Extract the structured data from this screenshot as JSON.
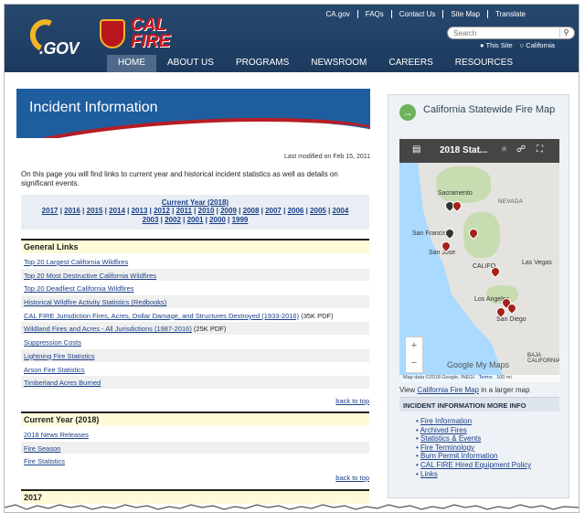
{
  "header": {
    "logo_ca": ".GOV",
    "logo_calfire": "CAL\nFIRE",
    "util_links": [
      "CA.gov",
      "FAQs",
      "Contact Us",
      "Site Map",
      "Translate"
    ],
    "search_placeholder": "Search",
    "scope_site": "This Site",
    "scope_state": "California",
    "nav": [
      "HOME",
      "ABOUT US",
      "PROGRAMS",
      "NEWSROOM",
      "CAREERS",
      "RESOURCES"
    ],
    "active_nav": "HOME"
  },
  "main": {
    "banner_title": "Incident Information",
    "modified": "Last modified on Feb 15, 2011",
    "intro": "On this page you will find links to current year and historical incident statistics as well as details on significant events.",
    "current_year_label": "Current Year (2018)",
    "years_row1": [
      "2017",
      "2016",
      "2015",
      "2014",
      "2013",
      "2012",
      "2011",
      "2010",
      "2009",
      "2008",
      "2007",
      "2006",
      "2005",
      "2004"
    ],
    "years_row2": [
      "2003",
      "2002",
      "2001",
      "2000",
      "1999"
    ],
    "general_links_heading": "General Links",
    "general_links": [
      {
        "label": "Top 20 Largest California Wildfires",
        "suffix": ""
      },
      {
        "label": "Top 20 Most Destructive California Wildfires",
        "suffix": ""
      },
      {
        "label": "Top 20 Deadliest California Wildfires",
        "suffix": ""
      },
      {
        "label": "Historical Wildfire Activity Statistics (Redbooks)",
        "suffix": ""
      },
      {
        "label": "CAL FIRE Jurisdiction Fires, Acres, Dollar Damage, and Structures Destroyed (1933-2016)",
        "suffix": " (35K PDF)"
      },
      {
        "label": "Wildland Fires and Acres - All Jurisdictions (1987-2016)",
        "suffix": " (25K PDF)"
      },
      {
        "label": "Suppression Costs",
        "suffix": ""
      },
      {
        "label": "Lightning Fire Statistics",
        "suffix": ""
      },
      {
        "label": "Arson Fire Statistics",
        "suffix": ""
      },
      {
        "label": "Timberland Acres Burned",
        "suffix": ""
      }
    ],
    "back_to_top": "back to top",
    "current_year_heading": "Current Year (2018)",
    "current_year_links": [
      "2018 News Releases",
      "Fire Season",
      "Fire Statistics"
    ],
    "year_2017_heading": "2017"
  },
  "sidebar": {
    "title": "California Statewide Fire Map",
    "map_title": "2018 Stat...",
    "state_label": "NEVADA",
    "cities": [
      "Sacramento",
      "San Francisco",
      "San Jose",
      "Las Vegas",
      "Los Angeles",
      "San Diego",
      "BAJA CALIFORNIA",
      "CALIFO"
    ],
    "google_label": "Google My Maps",
    "map_data": "Map data ©2018 Google, INEGI",
    "terms": "Terms",
    "scale": "100 mi",
    "view_prefix": "View ",
    "view_link": "California Fire Map",
    "view_suffix": " in a larger map",
    "more_heading": "INCIDENT INFORMATION MORE INFO",
    "more_links": [
      "Fire Information",
      "Archived Fires",
      "Statistics & Events",
      "Fire Terminology",
      "Burn Permit Information",
      "CAL FIRE Hired Equipment Policy",
      "Links"
    ]
  }
}
